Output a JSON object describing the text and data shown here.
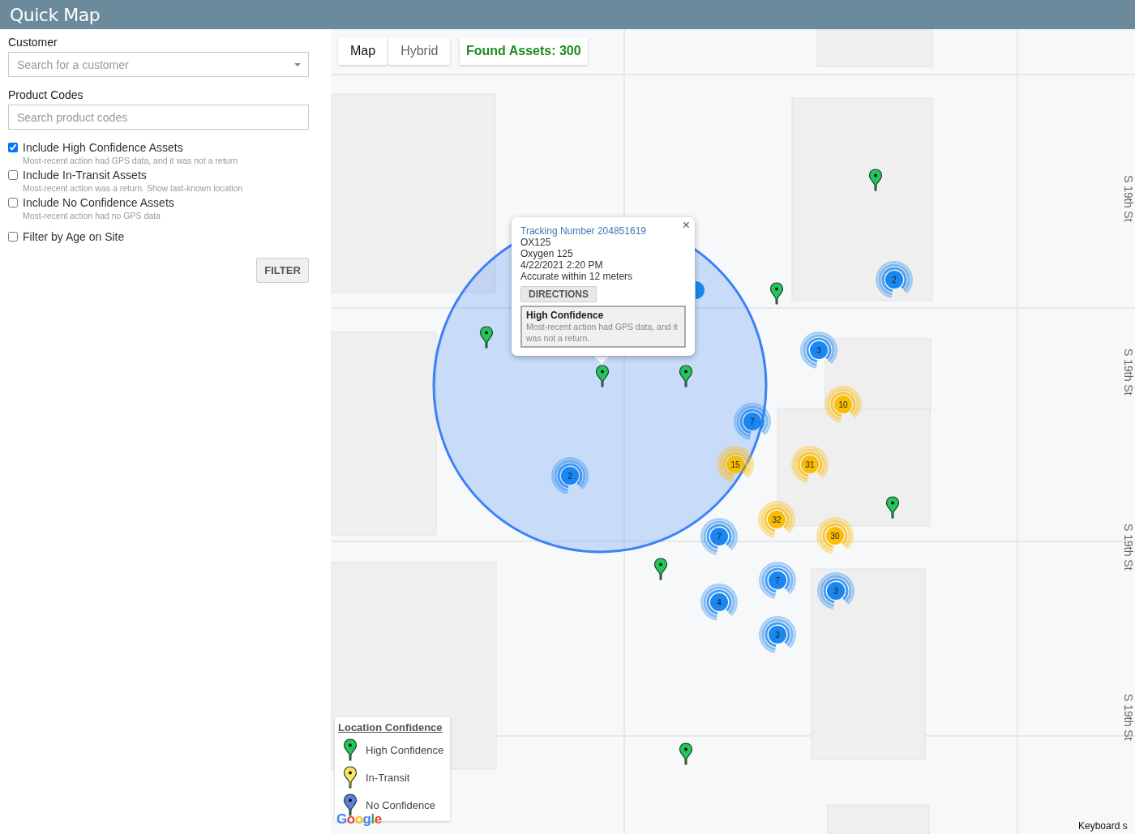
{
  "header": {
    "title": "Quick Map"
  },
  "sidebar": {
    "customer": {
      "label": "Customer",
      "placeholder": "Search for a customer"
    },
    "product_codes": {
      "label": "Product Codes",
      "placeholder": "Search product codes"
    },
    "options": [
      {
        "label": "Include High Confidence Assets",
        "description": "Most-recent action had GPS data, and it was not a return",
        "checked": true
      },
      {
        "label": "Include In-Transit Assets",
        "description": "Most-recent action was a return. Show last-known location",
        "checked": false
      },
      {
        "label": "Include No Confidence Assets",
        "description": "Most-recent action had no GPS data",
        "checked": false
      },
      {
        "label": "Filter by Age on Site",
        "checked": false
      }
    ],
    "filter_button": "FILTER"
  },
  "map": {
    "map_types": [
      {
        "label": "Map",
        "selected": true
      },
      {
        "label": "Hybrid",
        "selected": false
      }
    ],
    "found_assets": "Found Assets: 300",
    "pins": [
      {
        "kind": "high"
      },
      {
        "kind": "high"
      },
      {
        "kind": "high"
      },
      {
        "kind": "high"
      },
      {
        "kind": "high"
      },
      {
        "kind": "high"
      },
      {
        "kind": "high"
      },
      {
        "kind": "high"
      }
    ],
    "clusters": [
      {
        "count": "2",
        "color": "#1a86f0"
      },
      {
        "color": "#1a86f0"
      },
      {
        "count": "3",
        "color": "#1a86f0"
      },
      {
        "count": "10",
        "color": "#fbbc04"
      },
      {
        "count": "7",
        "color": "#1a86f0"
      },
      {
        "count": "15",
        "color": "#fbbc04"
      },
      {
        "count": "31",
        "color": "#fbbc04"
      },
      {
        "count": "2",
        "color": "#1a86f0"
      },
      {
        "count": "32",
        "color": "#fbbc04"
      },
      {
        "count": "30",
        "color": "#fbbc04"
      },
      {
        "count": "7",
        "color": "#1a86f0"
      },
      {
        "count": "7",
        "color": "#1a86f0"
      },
      {
        "count": "3",
        "color": "#1a86f0"
      },
      {
        "count": "4",
        "color": "#1a86f0"
      },
      {
        "count": "3",
        "color": "#1a86f0"
      }
    ],
    "popup": {
      "title": "Tracking Number 204851619",
      "lines": [
        "OX125",
        "Oxygen 125",
        "4/22/2021 2:20 PM",
        "Accurate within 12 meters"
      ],
      "button": "DIRECTIONS",
      "close": "×",
      "confidence": {
        "title": "High Confidence",
        "description": "Most-recent action had GPS data, and it was not a return."
      }
    },
    "legend": {
      "title": "Location Confidence",
      "items": [
        {
          "label": "High Confidence",
          "color": "#22c55e"
        },
        {
          "label": "In-Transit",
          "color": "#f5e663"
        },
        {
          "label": "No Confidence",
          "color": "#5b7fe0"
        }
      ]
    },
    "street_labels": [
      "S 19th St",
      "S 19th St",
      "S 19th St",
      "S 19th St"
    ],
    "google_logo": "Google",
    "keyboard_link": "Keyboard s"
  }
}
